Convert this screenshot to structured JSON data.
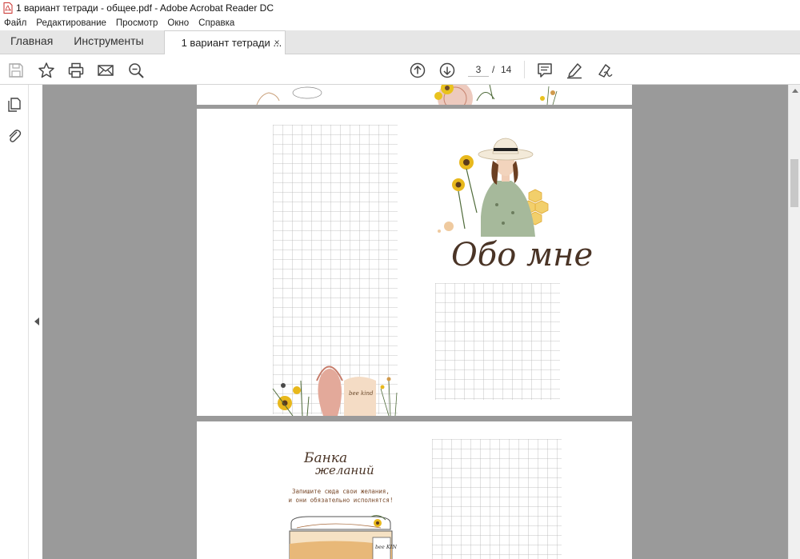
{
  "window": {
    "title": "1 вариант тетради - общее.pdf - Adobe Acrobat Reader DC"
  },
  "menu": {
    "items": [
      "Файл",
      "Редактирование",
      "Просмотр",
      "Окно",
      "Справка"
    ]
  },
  "tabs": {
    "home": "Главная",
    "tools": "Инструменты",
    "document": "1 вариант тетради ...",
    "close_glyph": "×"
  },
  "toolbar": {
    "page_current": "3",
    "page_separator": "/",
    "page_total": "14",
    "icons": [
      "save-icon",
      "bookmark-star-icon",
      "print-icon",
      "email-icon",
      "zoom-out-icon",
      "page-up-icon",
      "page-down-icon",
      "comment-icon",
      "highlight-pen-icon",
      "sign-icon"
    ]
  },
  "left_panel": {
    "icons": [
      "pages-thumbnails-icon",
      "attachments-icon"
    ]
  },
  "document": {
    "page2_title": "Обо мне",
    "page3_title_line1": "Банка",
    "page3_title_line2": "желаний",
    "page3_caption_line1": "Запишите сюда свои желания,",
    "page3_caption_line2": "и они обязательно исполнятся!",
    "tshirt_text": "bee kind",
    "jar_tag_text": "bee KIND"
  },
  "colors": {
    "accent_brown": "#4a3426",
    "caption_brown": "#7a4b2c",
    "pdf_red": "#d32f2f",
    "workspace_gray": "#9a9a9a"
  }
}
